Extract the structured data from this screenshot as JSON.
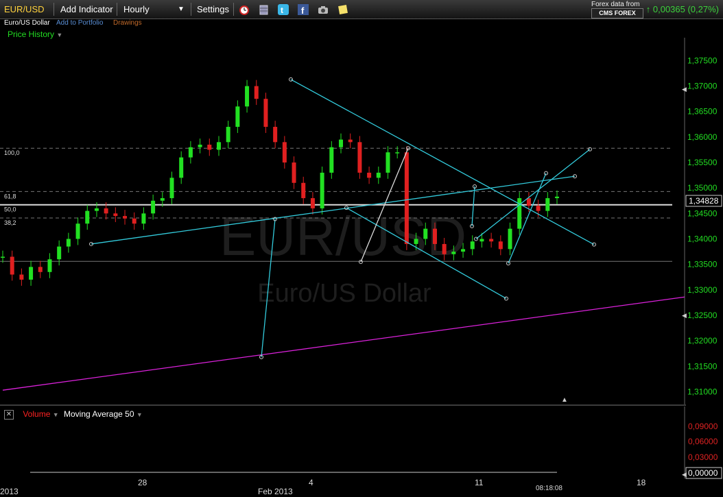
{
  "toolbar": {
    "symbol": "EUR/USD",
    "add_indicator": "Add Indicator",
    "interval": "Hourly",
    "settings": "Settings",
    "provider_line": "Forex data from",
    "provider_name": "CMS FOREX",
    "change": "0,00365 (0,27%)",
    "icons": [
      "alarm-clock-icon",
      "database-icon",
      "twitter-icon",
      "facebook-icon",
      "camera-icon",
      "notes-icon"
    ]
  },
  "subheader": {
    "instrument": "Euro/US Dollar",
    "add_to_portfolio": "Add to Portfolio",
    "drawings": "Drawings",
    "price_history": "Price History"
  },
  "watermark": {
    "symbol": "EUR/USD",
    "name": "Euro/US Dollar"
  },
  "fib_labels": [
    "100,0",
    "61,8",
    "50,0",
    "38,2"
  ],
  "current_price": "1,34828",
  "time_label": "08:18:08",
  "x_ticks": [
    "2013",
    "28",
    "Feb 2013",
    "4",
    "11",
    "18"
  ],
  "volume_panel": {
    "volume_label": "Volume",
    "ma_label": "Moving Average 50",
    "ticks": [
      "0,09000",
      "0,06000",
      "0,03000"
    ],
    "current": "0,00000"
  },
  "colors": {
    "up": "#22e022",
    "down": "#e02020",
    "trendline": "#33ccdd",
    "support": "#dd22dd",
    "axis_text": "#22dd22"
  },
  "chart_data": {
    "type": "line",
    "title": "EUR/USD",
    "ylabel": "",
    "ylim": [
      1.3075,
      1.3795
    ],
    "y_ticks": [
      "1,37500",
      "1,37000",
      "1,36500",
      "1,36000",
      "1,35500",
      "1,35000",
      "1,34500",
      "1,34000",
      "1,33500",
      "1,33000",
      "1,32500",
      "1,32000",
      "1,31500",
      "1,31000"
    ],
    "series": [
      {
        "values": [
          1.3365,
          1.333,
          1.332,
          1.3345,
          1.3335,
          1.336,
          1.3385,
          1.34,
          1.343,
          1.3455,
          1.346,
          1.345,
          1.3445,
          1.344,
          1.343,
          1.345,
          1.3475,
          1.348,
          1.352,
          1.356,
          1.358,
          1.3585,
          1.3575,
          1.359,
          1.362,
          1.366,
          1.37,
          1.3675,
          1.362,
          1.359,
          1.355,
          1.351,
          1.348,
          1.346,
          1.353,
          1.358,
          1.3595,
          1.359,
          1.353,
          1.352,
          1.353,
          1.357,
          1.357,
          1.339,
          1.34,
          1.342,
          1.339,
          1.337,
          1.3375,
          1.338,
          1.3395,
          1.34,
          1.3395,
          1.338,
          1.342,
          1.348,
          1.3465,
          1.3455,
          1.348,
          1.3483
        ]
      }
    ],
    "fib_levels": {
      "100,0": 1.3578,
      "61,8": 1.3493,
      "50,0": 1.3467,
      "38,2": 1.3441
    },
    "support_level": 1.3356,
    "grid": false
  }
}
